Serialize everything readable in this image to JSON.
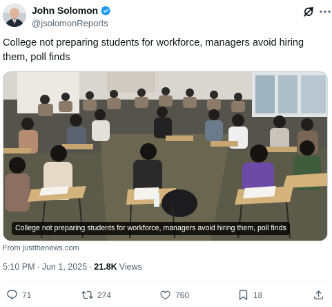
{
  "author": {
    "display_name": "John Solomon",
    "handle": "@jsolomonReports",
    "avatar_icon": "avatar-photo",
    "verified_icon": "verified-badge-icon",
    "verified_color": "#1d9bf0"
  },
  "header_icons": [
    "grok-icon",
    "more-icon"
  ],
  "tweet": {
    "text": "College not preparing students for workforce, managers avoid hiring them, poll finds"
  },
  "card": {
    "image": "classroom-students-writing-exam-photo",
    "caption": "College not preparing students for workforce, managers avoid hiring them, poll finds",
    "source": "From justthenews.com"
  },
  "meta": {
    "time": "5:10 PM",
    "separator": "·",
    "date": "Jun 1, 2025",
    "separator2": "·",
    "views_count": "21.8K",
    "views_label": "Views"
  },
  "actions": {
    "reply": {
      "icon": "reply-icon",
      "count": "71"
    },
    "repost": {
      "icon": "repost-icon",
      "count": "274"
    },
    "like": {
      "icon": "like-icon",
      "count": "760"
    },
    "bookmark": {
      "icon": "bookmark-icon",
      "count": "18"
    },
    "share": {
      "icon": "share-icon"
    }
  },
  "colors": {
    "text_primary": "#0f1419",
    "text_secondary": "#536471",
    "border": "#cfd9de"
  }
}
